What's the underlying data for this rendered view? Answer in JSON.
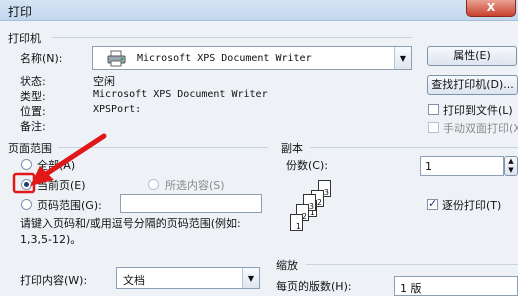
{
  "window": {
    "title": "打印",
    "close_label": "X"
  },
  "printer": {
    "group_label": "打印机",
    "name_label": "名称(N):",
    "name_value": "Microsoft XPS Document Writer",
    "status_label": "状态:",
    "status_value": "空闲",
    "type_label": "类型:",
    "type_value": "Microsoft XPS Document Writer",
    "location_label": "位置:",
    "location_value": "XPSPort:",
    "comment_label": "备注:",
    "properties_button": "属性(E)",
    "find_button": "查找打印机(D)...",
    "print_to_file_label": "打印到文件(L)",
    "print_to_file_checked": false,
    "manual_duplex_label": "手动双面打印(X)",
    "manual_duplex_checked": false
  },
  "page_range": {
    "group_label": "页面范围",
    "all_label": "全部(A)",
    "current_label": "当前页(E)",
    "selection_label": "所选内容(S)",
    "pages_label": "页码范围(G):",
    "pages_value": "",
    "selected_option": "current",
    "hint": "请键入页码和/或用逗号分隔的页码范围(例如: 1,3,5-12)。"
  },
  "copies": {
    "group_label": "副本",
    "count_label": "份数(C):",
    "count_value": "1",
    "collate_label": "逐份打印(T)",
    "collate_checked": true,
    "page_numbers": [
      "3",
      "2",
      "1"
    ]
  },
  "print_what": {
    "label": "打印内容(W):",
    "value": "文档"
  },
  "zoom": {
    "group_label": "缩放",
    "pages_per_sheet_label": "每页的版数(H):",
    "pages_per_sheet_value": "1 版"
  },
  "colors": {
    "annotation_arrow": "#e01818",
    "accent": "#1d3c75"
  }
}
